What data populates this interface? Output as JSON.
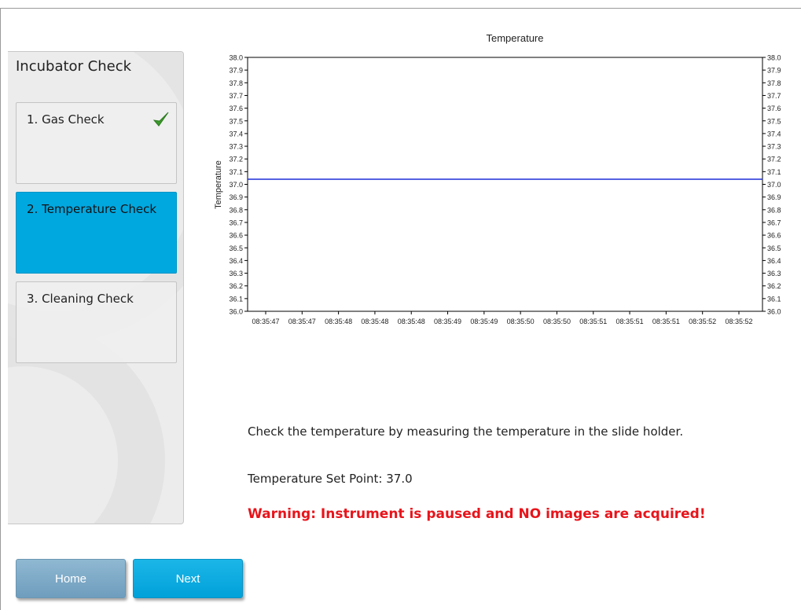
{
  "sidebar": {
    "title": "Incubator Check",
    "steps": [
      {
        "label": "1. Gas Check",
        "completed": true,
        "active": false
      },
      {
        "label": "2. Temperature Check",
        "completed": false,
        "active": true
      },
      {
        "label": "3. Cleaning Check",
        "completed": false,
        "active": false
      }
    ]
  },
  "buttons": {
    "home_label": "Home",
    "next_label": "Next"
  },
  "content": {
    "instruction": "Check the temperature by measuring the temperature in the slide holder.",
    "set_point": "Temperature Set Point: 37.0",
    "warning": "Warning: Instrument is paused and NO images are acquired!"
  },
  "colors": {
    "active_step": "#00a8e0",
    "check": "#3a9a2a",
    "warning": "#e8141b",
    "series": "#1e2fd8"
  },
  "chart_data": {
    "type": "line",
    "title": "Temperature",
    "ylabel": "Temperature",
    "xlabel": "",
    "ylim": [
      36.0,
      38.0
    ],
    "y_ticks": [
      "36.0",
      "36.1",
      "36.2",
      "36.3",
      "36.4",
      "36.5",
      "36.6",
      "36.7",
      "36.8",
      "36.9",
      "37.0",
      "37.1",
      "37.2",
      "37.3",
      "37.4",
      "37.5",
      "37.6",
      "37.7",
      "37.8",
      "37.9",
      "38.0"
    ],
    "x_tick_labels": [
      "08:35:47",
      "08:35:47",
      "08:35:48",
      "08:35:48",
      "08:35:48",
      "08:35:49",
      "08:35:49",
      "08:35:50",
      "08:35:50",
      "08:35:51",
      "08:35:51",
      "08:35:51",
      "08:35:52",
      "08:35:52"
    ],
    "right_axis": true,
    "grid": false,
    "series": [
      {
        "values": [
          37.04,
          37.04
        ]
      }
    ]
  }
}
